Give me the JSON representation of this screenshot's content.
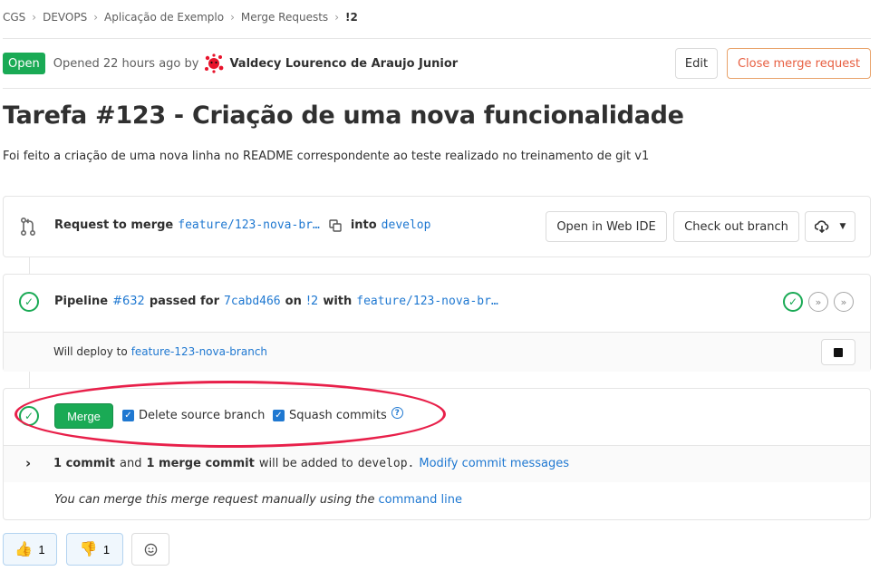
{
  "breadcrumb": [
    "CGS",
    "DEVOPS",
    "Aplicação de Exemplo",
    "Merge Requests",
    "!2"
  ],
  "header": {
    "status": "Open",
    "opened_text": "Opened 22 hours ago by",
    "author": "Valdecy Lourenco de Araujo Junior",
    "edit_label": "Edit",
    "close_label": "Close merge request"
  },
  "title": "Tarefa #123 - Criação de uma nova funcionalidade",
  "description": "Foi feito a criação de uma nova linha no README correspondente ao teste realizado no treinamento de git v1",
  "request": {
    "label": "Request to merge",
    "source_branch": "feature/123-nova-br…",
    "into": "into",
    "target_branch": "develop",
    "web_ide_label": "Open in Web IDE",
    "checkout_label": "Check out branch"
  },
  "pipeline": {
    "label": "Pipeline",
    "id": "#632",
    "passed_for": "passed for",
    "commit": "7cabd466",
    "on": "on",
    "mr": "!2",
    "with": "with",
    "branch": "feature/123-nova-br…",
    "deploy_text": "Will deploy to",
    "deploy_target": "feature-123-nova-branch"
  },
  "merge": {
    "button_label": "Merge",
    "delete_source": "Delete source branch",
    "squash": "Squash commits",
    "commits_count": "1 commit",
    "and": "and",
    "merge_commits": "1 merge commit",
    "will_be_added": "will be added to",
    "target": "develop.",
    "modify_link": "Modify commit messages",
    "manual_text": "You can merge this merge request manually using the",
    "command_line": "command line"
  },
  "reactions": {
    "thumbs_up_count": "1",
    "thumbs_down_count": "1"
  },
  "colors": {
    "accent": "#1f78d1",
    "success": "#1aaa55",
    "danger": "#e75e40",
    "highlight": "#e8204a"
  }
}
